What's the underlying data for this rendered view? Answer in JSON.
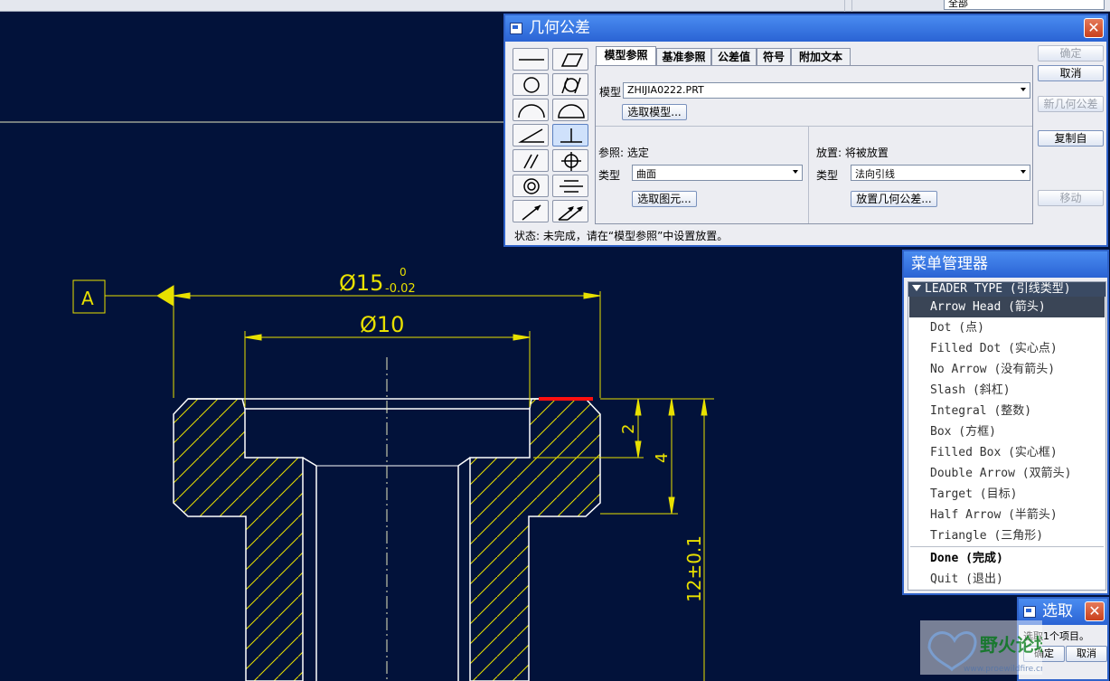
{
  "topbar": {
    "combo_value": "全部"
  },
  "drawing": {
    "datum_label": "A",
    "dim_outer": "Ø15",
    "dim_outer_tol_upper": "0",
    "dim_outer_tol_lower": "-0.02",
    "dim_inner": "Ø10",
    "dim_depth_2": "2",
    "dim_depth_4": "4",
    "dim_height": "12±0.1"
  },
  "gtol_dialog": {
    "title": "几何公差",
    "tabs": [
      "模型参照",
      "基准参照",
      "公差值",
      "符号",
      "附加文本"
    ],
    "model_label": "模型",
    "model_value": "ZHIJIA0222.PRT",
    "select_model_button": "选取模型...",
    "ref_label": "参照: 选定",
    "ref_type_label": "类型",
    "ref_type_value": "曲面",
    "select_entity_button": "选取图元...",
    "place_label": "放置: 将被放置",
    "place_type_label": "类型",
    "place_type_value": "法向引线",
    "place_button": "放置几何公差...",
    "buttons": {
      "ok": "确定",
      "cancel": "取消",
      "new": "新几何公差",
      "copy": "复制自",
      "move": "移动"
    },
    "status": "状态: 未完成，请在“模型参照”中设置放置。"
  },
  "menu_manager": {
    "title": "菜单管理器",
    "header": "LEADER TYPE (引线类型)",
    "items": [
      "Arrow Head (箭头)",
      "Dot (点)",
      "Filled Dot (实心点)",
      "No Arrow (没有箭头)",
      "Slash (斜杠)",
      "Integral (整数)",
      "Box (方框)",
      "Filled Box (实心框)",
      "Double Arrow (双箭头)",
      "Target (目标)",
      "Half Arrow (半箭头)",
      "Triangle (三角形)"
    ],
    "done": "Done (完成)",
    "quit": "Quit (退出)"
  },
  "pick_dialog": {
    "title": "选取",
    "message": "选取1个项目。",
    "ok": "确定",
    "cancel": "取消"
  },
  "watermark": {
    "text": "野火论坛",
    "url": "www.proewildfire.cn"
  }
}
